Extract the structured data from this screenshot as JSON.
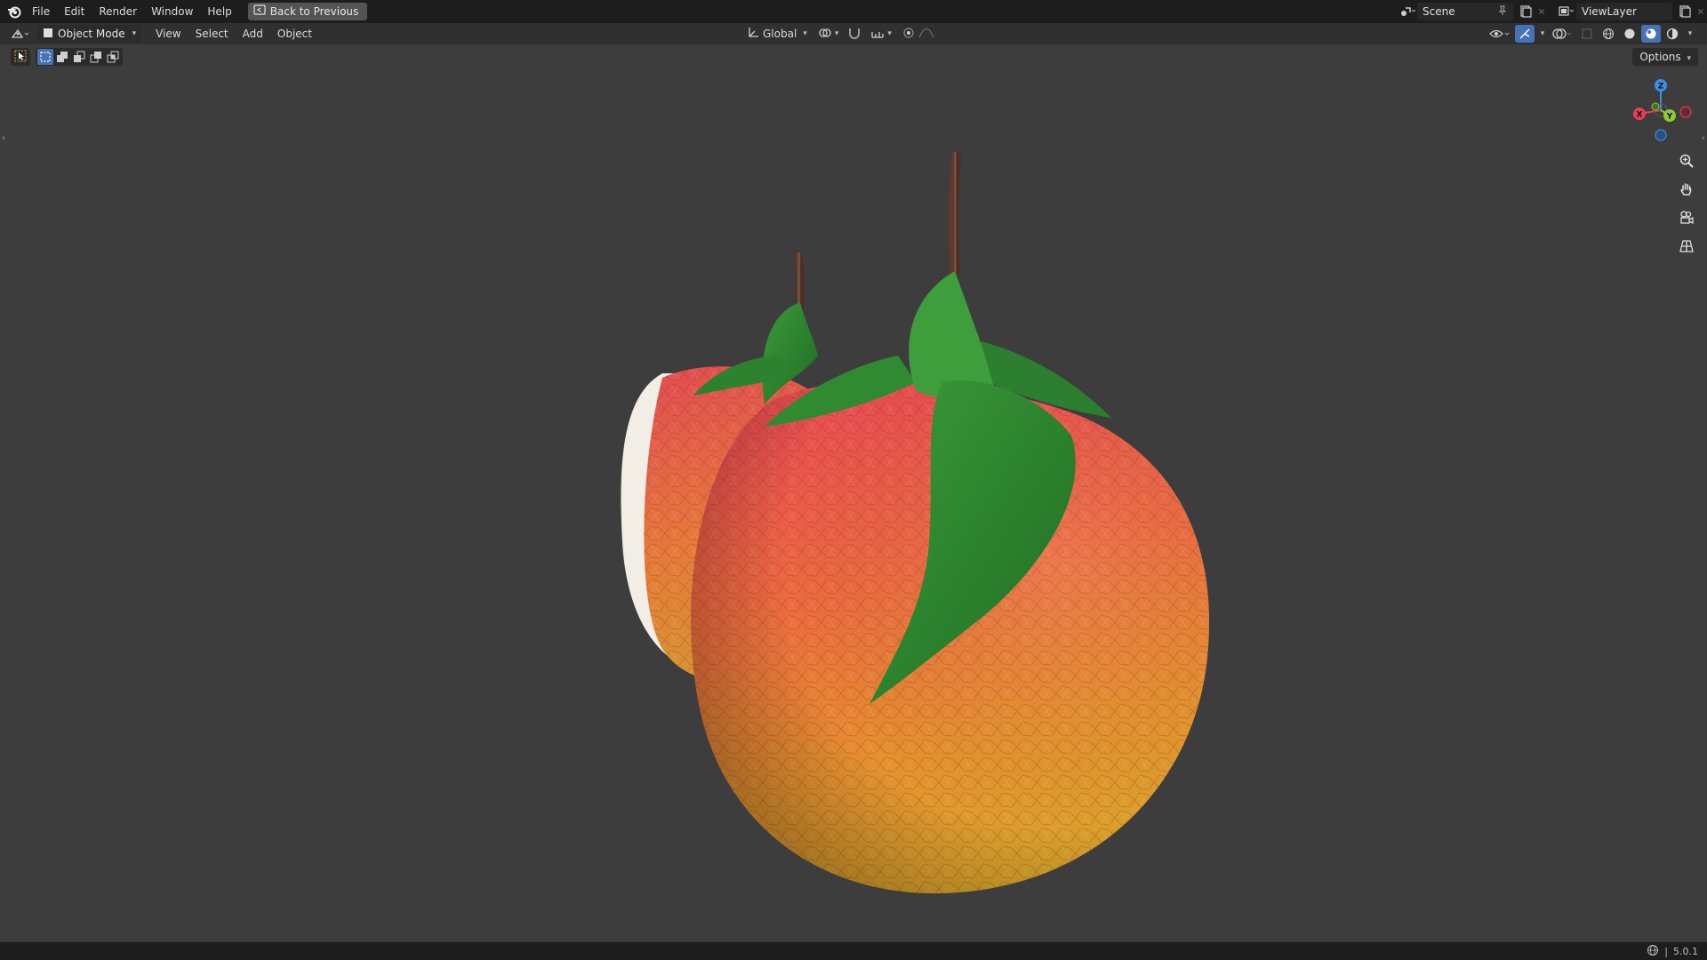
{
  "topbar": {
    "menu": [
      "File",
      "Edit",
      "Render",
      "Window",
      "Help"
    ],
    "back_button": "Back to Previous",
    "scene_name": "Scene",
    "view_layer": "ViewLayer"
  },
  "header": {
    "mode": "Object Mode",
    "menu": [
      "View",
      "Select",
      "Add",
      "Object"
    ],
    "transform_orientation": "Global",
    "options_label": "Options"
  },
  "gizmo": {
    "x": "X",
    "y": "Y",
    "z": "Z"
  },
  "status": {
    "version": "5.0.1"
  },
  "colors": {
    "accent": "#4772b3",
    "axis_x": "#e83e55",
    "axis_y": "#8ccb32",
    "axis_z": "#3d8ee8"
  }
}
